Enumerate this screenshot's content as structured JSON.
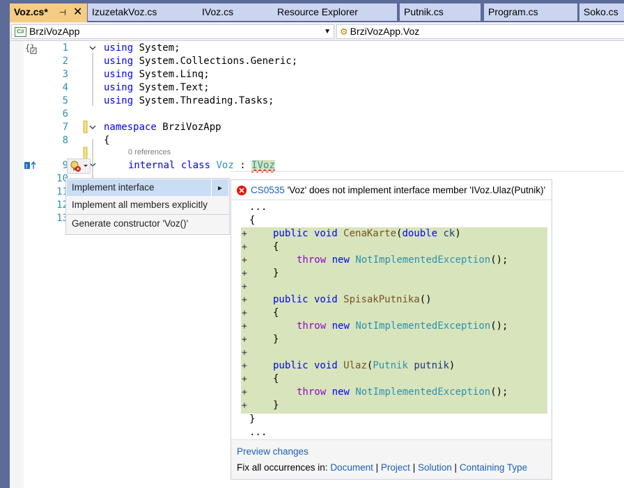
{
  "tabs": [
    {
      "label": "Voz.cs*",
      "active": true,
      "pin": "⊣",
      "close": "✕"
    },
    {
      "label": "IzuzetakVoz.cs"
    },
    {
      "label": "IVoz.cs"
    },
    {
      "label": "Resource Explorer"
    },
    {
      "label": "Putnik.cs"
    },
    {
      "label": "Program.cs"
    },
    {
      "label": "Soko.cs"
    }
  ],
  "navbar": {
    "project_badge": "C#",
    "project": "BrziVozApp",
    "type": "BrziVozApp.Voz",
    "dropdown_arrow": "▼"
  },
  "code": {
    "line_numbers": [
      "1",
      "2",
      "3",
      "4",
      "5",
      "6",
      "7",
      "8",
      "9",
      "10",
      "11",
      "12",
      "13"
    ],
    "codelens": "0 references",
    "lines": [
      {
        "kw": "using",
        "rest": " System;"
      },
      {
        "kw": "using",
        "rest": " System.Collections.Generic;"
      },
      {
        "kw": "using",
        "rest": " System.Linq;"
      },
      {
        "kw": "using",
        "rest": " System.Text;"
      },
      {
        "kw": "using",
        "rest": " System.Threading.Tasks;"
      },
      {
        "kw": "namespace",
        "rest": " BrziVozApp"
      },
      {
        "text": "{"
      },
      {
        "kw1": "internal",
        "kw2": "class",
        "cls": "Voz",
        "colon": " : ",
        "iface": "IVoz"
      }
    ]
  },
  "menu": {
    "items": [
      {
        "label": "Implement interface",
        "selected": true,
        "arrow": "▸"
      },
      {
        "label": "Implement all members explicitly"
      },
      {
        "label": "Generate constructor 'Voz()'"
      }
    ]
  },
  "preview": {
    "error_code": "CS0535",
    "error_message": "'Voz' does not implement interface member 'IVoz.Ulaz(Putnik)'",
    "ellipsis_top": "...",
    "brace_open": "{",
    "brace_close": "}",
    "ellipsis_bottom": "...",
    "methods": [
      {
        "modifiers": "public void",
        "name": "CenaKarte",
        "params_type": "double",
        "params_name": "ck"
      },
      {
        "modifiers": "public void",
        "name": "SpisakPutnika",
        "params_type": "",
        "params_name": ""
      },
      {
        "modifiers": "public void",
        "name": "Ulaz",
        "params_type": "Putnik",
        "params_name": "putnik"
      }
    ],
    "throw_kw": "throw",
    "new_kw": "new",
    "exception": "NotImplementedException",
    "exception_tail": "();",
    "preview_changes": "Preview changes",
    "fix_all_label": "Fix all occurrences in:",
    "scopes": [
      "Document",
      "Project",
      "Solution",
      "Containing Type"
    ],
    "separator": "|"
  },
  "colors": {
    "frame": "#5d6b99",
    "active_tab": "#f5cc84",
    "inactive_tab": "#ccd5f0",
    "keyword": "#0000ff",
    "type": "#2b91af",
    "control": "#8f08c4",
    "diff_added": "#d8e4bc",
    "menu_selected": "#c9def5",
    "error": "#e51400"
  }
}
